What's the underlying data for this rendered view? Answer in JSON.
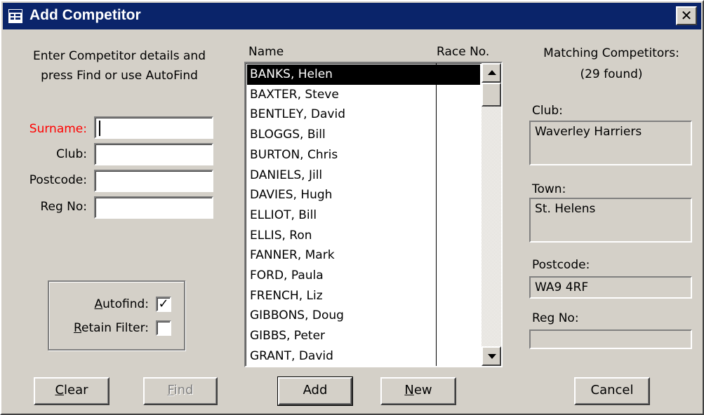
{
  "window": {
    "title": "Add Competitor",
    "close_glyph": "✕"
  },
  "colors": {
    "titlebar": "#0a246a",
    "required_label": "#ff0000",
    "face": "#d4d0c8"
  },
  "instructions": {
    "line1": "Enter Competitor details and",
    "line2": "press Find or use AutoFind"
  },
  "form": {
    "surname_label": "Surname:",
    "club_label": "Club:",
    "postcode_label": "Postcode:",
    "regno_label": "Reg No:",
    "surname_value": "",
    "club_value": "",
    "postcode_value": "",
    "regno_value": ""
  },
  "options": {
    "autofind_key": "A",
    "autofind_rest": "utofind:",
    "autofind_checked": true,
    "retain_key": "R",
    "retain_rest": "etain Filter:",
    "retain_checked": false
  },
  "list": {
    "col_name": "Name",
    "col_race": "Race No.",
    "selected_index": 0,
    "rows": [
      {
        "name": "BANKS, Helen",
        "race": ""
      },
      {
        "name": "BAXTER, Steve",
        "race": ""
      },
      {
        "name": "BENTLEY, David",
        "race": ""
      },
      {
        "name": "BLOGGS, Bill",
        "race": ""
      },
      {
        "name": "BURTON, Chris",
        "race": ""
      },
      {
        "name": "DANIELS, Jill",
        "race": ""
      },
      {
        "name": "DAVIES, Hugh",
        "race": ""
      },
      {
        "name": "ELLIOT, Bill",
        "race": ""
      },
      {
        "name": "ELLIS, Ron",
        "race": ""
      },
      {
        "name": "FANNER, Mark",
        "race": ""
      },
      {
        "name": "FORD, Paula",
        "race": ""
      },
      {
        "name": "FRENCH, Liz",
        "race": ""
      },
      {
        "name": "GIBBONS, Doug",
        "race": ""
      },
      {
        "name": "GIBBS, Peter",
        "race": ""
      },
      {
        "name": "GRANT, David",
        "race": ""
      }
    ]
  },
  "matching": {
    "heading": "Matching Competitors:",
    "count": "(29 found)",
    "club_label": "Club:",
    "club_value": "Waverley Harriers",
    "town_label": "Town:",
    "town_value": "St. Helens",
    "postcode_label": "Postcode:",
    "postcode_value": "WA9 4RF",
    "regno_label": "Reg No:",
    "regno_value": ""
  },
  "buttons": {
    "clear_key": "C",
    "clear_rest": "lear",
    "find_key": "F",
    "find_rest": "ind",
    "add": "Add",
    "new_key": "N",
    "new_rest": "ew",
    "cancel": "Cancel"
  },
  "icons": {
    "title": "form-icon",
    "close": "close-icon",
    "scroll_up": "arrow-up-icon",
    "scroll_down": "arrow-down-icon",
    "check": "checkmark-icon"
  }
}
